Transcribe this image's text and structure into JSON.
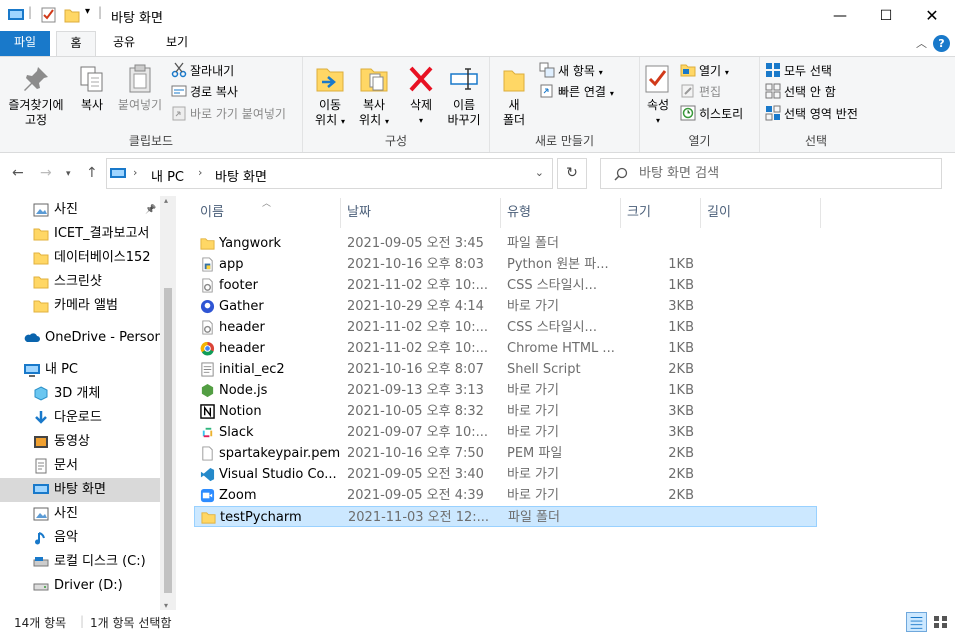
{
  "window": {
    "title": "바탕 화면"
  },
  "ribbon_tabs": [
    "파일",
    "홈",
    "공유",
    "보기"
  ],
  "ribbon": {
    "clipboard": {
      "pin_quick": [
        "즐겨찾기에",
        "고정"
      ],
      "copy": "복사",
      "paste": "붙여넣기",
      "cut": "잘라내기",
      "copy_path": "경로 복사",
      "paste_shortcut": "바로 가기 붙여넣기",
      "label": "클립보드"
    },
    "organize": {
      "move_to": [
        "이동",
        "위치"
      ],
      "copy_to": [
        "복사",
        "위치"
      ],
      "delete": "삭제",
      "rename": [
        "이름",
        "바꾸기"
      ],
      "label": "구성"
    },
    "new": {
      "new_folder": [
        "새",
        "폴더"
      ],
      "new_item": "새 항목",
      "easy_access": "빠른 연결",
      "label": "새로 만들기"
    },
    "open": {
      "properties": "속성",
      "open": "열기",
      "edit": "편집",
      "history": "히스토리",
      "label": "열기"
    },
    "select": {
      "select_all": "모두 선택",
      "select_none": "선택 안 함",
      "invert": "선택 영역 반전",
      "label": "선택"
    }
  },
  "address": {
    "segments": [
      "내 PC",
      "바탕 화면"
    ],
    "search_placeholder": "바탕 화면 검색"
  },
  "nav_pane": {
    "quick_items": [
      {
        "label": "사진",
        "icon": "pictures-icon"
      },
      {
        "label": "ICET_결과보고서",
        "icon": "folder-icon"
      },
      {
        "label": "데이터베이스152",
        "icon": "folder-icon"
      },
      {
        "label": "스크린샷",
        "icon": "folder-icon"
      },
      {
        "label": "카메라 앨범",
        "icon": "folder-icon"
      }
    ],
    "onedrive": "OneDrive - Person",
    "this_pc": "내 PC",
    "pc_items": [
      {
        "label": "3D 개체",
        "icon": "3d-objects-icon"
      },
      {
        "label": "다운로드",
        "icon": "downloads-icon"
      },
      {
        "label": "동영상",
        "icon": "videos-icon"
      },
      {
        "label": "문서",
        "icon": "documents-icon"
      },
      {
        "label": "바탕 화면",
        "icon": "desktop-icon"
      },
      {
        "label": "사진",
        "icon": "pictures-icon"
      },
      {
        "label": "음악",
        "icon": "music-icon"
      },
      {
        "label": "로컬 디스크 (C:)",
        "icon": "local-disk-icon"
      },
      {
        "label": "Driver (D:)",
        "icon": "drive-icon"
      }
    ]
  },
  "columns": [
    "이름",
    "날짜",
    "유형",
    "크기",
    "길이"
  ],
  "files": [
    {
      "name": "Yangwork",
      "date": "2021-09-05 오전 3:45",
      "type": "파일 폴더",
      "size": "",
      "icon": "folder-icon"
    },
    {
      "name": "app",
      "date": "2021-10-16 오후 8:03",
      "type": "Python 원본 파...",
      "size": "1KB",
      "icon": "python-file-icon"
    },
    {
      "name": "footer",
      "date": "2021-11-02 오후 10:...",
      "type": "CSS 스타일시...",
      "size": "1KB",
      "icon": "css-file-icon"
    },
    {
      "name": "Gather",
      "date": "2021-10-29 오후 4:14",
      "type": "바로 가기",
      "size": "3KB",
      "icon": "gather-shortcut-icon"
    },
    {
      "name": "header",
      "date": "2021-11-02 오후 10:...",
      "type": "CSS 스타일시...",
      "size": "1KB",
      "icon": "css-file-icon"
    },
    {
      "name": "header",
      "date": "2021-11-02 오후 10:...",
      "type": "Chrome HTML ...",
      "size": "1KB",
      "icon": "chrome-html-icon"
    },
    {
      "name": "initial_ec2",
      "date": "2021-10-16 오후 8:07",
      "type": "Shell Script",
      "size": "2KB",
      "icon": "shell-script-icon"
    },
    {
      "name": "Node.js",
      "date": "2021-09-13 오후 3:13",
      "type": "바로 가기",
      "size": "1KB",
      "icon": "nodejs-shortcut-icon"
    },
    {
      "name": "Notion",
      "date": "2021-10-05 오후 8:32",
      "type": "바로 가기",
      "size": "3KB",
      "icon": "notion-shortcut-icon"
    },
    {
      "name": "Slack",
      "date": "2021-09-07 오후 10:...",
      "type": "바로 가기",
      "size": "3KB",
      "icon": "slack-shortcut-icon"
    },
    {
      "name": "spartakeypair.pem",
      "date": "2021-10-16 오후 7:50",
      "type": "PEM 파일",
      "size": "2KB",
      "icon": "pem-file-icon"
    },
    {
      "name": "Visual Studio Co...",
      "date": "2021-09-05 오전 3:40",
      "type": "바로 가기",
      "size": "2KB",
      "icon": "vscode-shortcut-icon"
    },
    {
      "name": "Zoom",
      "date": "2021-09-05 오전 4:39",
      "type": "바로 가기",
      "size": "2KB",
      "icon": "zoom-shortcut-icon"
    },
    {
      "name": "testPycharm",
      "date": "2021-11-03 오전 12:...",
      "type": "파일 폴더",
      "size": "",
      "icon": "folder-icon"
    }
  ],
  "status": {
    "count": "14개 항목",
    "selected": "1개 항목 선택함"
  },
  "colors": {
    "accent": "#1979ca",
    "selection": "#cce8ff",
    "folder": "#ffd765"
  }
}
